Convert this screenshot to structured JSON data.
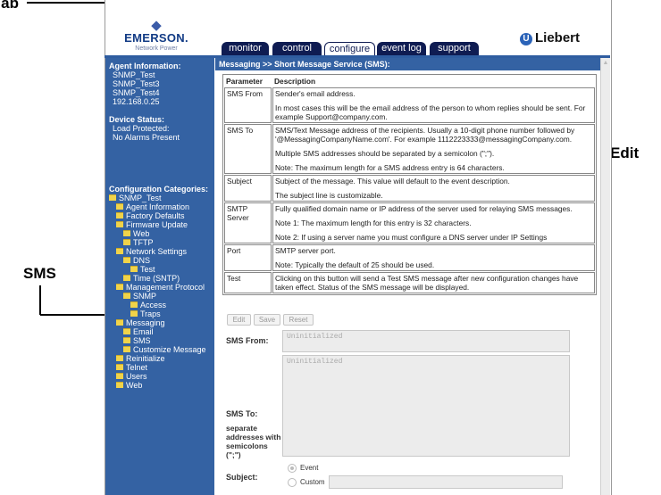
{
  "callouts": {
    "tab": "Tab",
    "edit": "Edit",
    "sms": "SMS"
  },
  "branding": {
    "emerson": "EMERSON.",
    "emerson_sub": "Network Power",
    "liebert": "Liebert",
    "liebert_mark": "U"
  },
  "tabs": [
    {
      "label": "monitor"
    },
    {
      "label": "control"
    },
    {
      "label": "configure",
      "active": true
    },
    {
      "label": "event log"
    },
    {
      "label": "support"
    }
  ],
  "sidebar": {
    "agent_header": "Agent Information:",
    "agent_lines": [
      "SNMP_Test",
      "SNMP_Test3",
      "SNMP_Test4",
      "192.168.0.25"
    ],
    "device_header": "Device Status:",
    "device_lines": [
      "Load Protected:",
      "No Alarms Present"
    ],
    "config_header": "Configuration Categories:",
    "tree": [
      {
        "label": "SNMP_Test",
        "level": 0
      },
      {
        "label": "Agent Information",
        "level": 1
      },
      {
        "label": "Factory Defaults",
        "level": 1
      },
      {
        "label": "Firmware Update",
        "level": 1
      },
      {
        "label": "Web",
        "level": 2
      },
      {
        "label": "TFTP",
        "level": 2
      },
      {
        "label": "Network Settings",
        "level": 1
      },
      {
        "label": "DNS",
        "level": 2
      },
      {
        "label": "Test",
        "level": 3
      },
      {
        "label": "Time (SNTP)",
        "level": 2
      },
      {
        "label": "Management Protocol",
        "level": 1
      },
      {
        "label": "SNMP",
        "level": 2
      },
      {
        "label": "Access",
        "level": 3
      },
      {
        "label": "Traps",
        "level": 3
      },
      {
        "label": "Messaging",
        "level": 1
      },
      {
        "label": "Email",
        "level": 2
      },
      {
        "label": "SMS",
        "level": 2
      },
      {
        "label": "Customize Message",
        "level": 2
      },
      {
        "label": "Reinitialize",
        "level": 1
      },
      {
        "label": "Telnet",
        "level": 1
      },
      {
        "label": "Users",
        "level": 1
      },
      {
        "label": "Web",
        "level": 1
      }
    ]
  },
  "content": {
    "header": "Messaging >> Short Message Service (SMS):",
    "table": {
      "col_param": "Parameter",
      "col_desc": "Description",
      "rows": [
        {
          "param": "SMS From",
          "desc": [
            "Sender's email address.",
            "In most cases this will be the email address of the person to whom replies should be sent. For example Support@company.com."
          ]
        },
        {
          "param": "SMS To",
          "desc": [
            "SMS/Text Message address of the recipients. Usually a 10-digit phone number followed by '@MessagingCompanyName.com'. For example 1112223333@messagingCompany.com.",
            "Multiple SMS addresses should be separated by a semicolon (\";\").",
            "Note: The maximum length for a SMS address entry is 64 characters."
          ]
        },
        {
          "param": "Subject",
          "desc": [
            "Subject of the message. This value will default to the event description.",
            "The subject line is customizable."
          ]
        },
        {
          "param": "SMTP Server",
          "desc": [
            "Fully qualified domain name or IP address of the server used for relaying SMS messages.",
            "Note 1: The maximum length for this entry is 32 characters.",
            "Note 2: If using a server name you must configure a DNS server under IP Settings"
          ]
        },
        {
          "param": "Port",
          "desc": [
            "SMTP server port.",
            "Note: Typically the default of 25 should be used."
          ]
        },
        {
          "param": "Test",
          "desc": [
            "Clicking on this button will send a Test SMS message after new configuration changes have taken effect. Status of the SMS message will be displayed."
          ]
        }
      ]
    },
    "buttons": {
      "edit": "Edit",
      "save": "Save",
      "reset": "Reset"
    },
    "form": {
      "sms_from_label": "SMS From:",
      "sms_from_value": "Uninitialized",
      "sms_to_label": "SMS To:",
      "sms_to_value": "Uninitialized",
      "sms_to_hint": "separate addresses with semicolons (\";\")",
      "subject_label": "Subject:",
      "subject_event": "Event",
      "subject_custom": "Custom"
    }
  }
}
